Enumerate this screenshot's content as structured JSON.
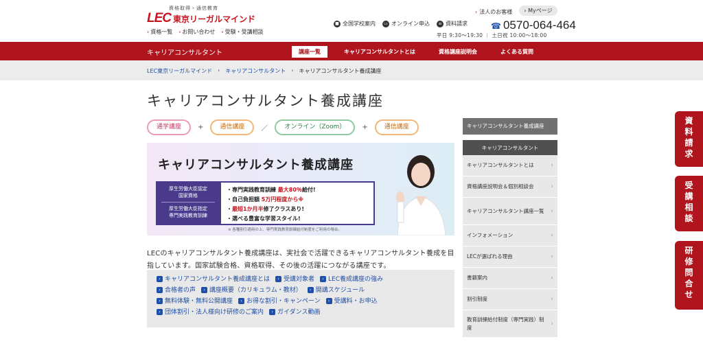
{
  "header": {
    "logo_sub": "資格取得・通信教育",
    "logo_mark": "LEC",
    "logo_name": "東京リーガルマインド",
    "links": [
      "資格一覧",
      "お問い合わせ",
      "受験・受講相談"
    ],
    "utility": [
      "全国学校案内",
      "オンライン申込",
      "資料請求"
    ],
    "corp_link": "法人のお客様",
    "mypage": "Myページ",
    "phone": "0570-064-464",
    "hours": "平日 9:30～19:30 ｜ 土日祝 10:00～18:00"
  },
  "redbar": {
    "title": "キャリアコンサルタント",
    "nav": [
      "講座一覧",
      "キャリアコンサルタントとは",
      "資格講座説明会",
      "よくある質問"
    ]
  },
  "breadcrumb": [
    "LEC東京リーガルマインド",
    "キャリアコンサルタント",
    "キャリアコンサルタント養成講座"
  ],
  "page_title": "キャリアコンサルタント養成講座",
  "pills": {
    "p1": "通学講座",
    "op1": "+",
    "p2": "通信講座",
    "op2": "／",
    "p3": "オンライン（Zoom）",
    "op3": "+",
    "p4": "通信講座"
  },
  "banner": {
    "title": "キャリアコンサルタント養成講座",
    "cert1": "厚生労働大臣認定",
    "cert2": "国家資格",
    "cert3": "厚生労働大臣指定",
    "cert4": "専門実践教育訓練",
    "p1a": "・専門実践教育訓練",
    "p1b": "最大80％",
    "p1c": "給付!",
    "p2a": "・自己負担額",
    "p2b": "5万円程度から※",
    "p3a": "・",
    "p3b": "最短1か月半",
    "p3c": "修了クラスあり!",
    "p4": "・選べる豊富な学習スタイル!",
    "note": "※ 各種割引適用の上、専門実践教育訓練給付制度をご利用の場合。"
  },
  "intro": "LECのキャリアコンサルタント養成講座は、実社会で活躍できるキャリアコンサルタント養成を目指しています。国家試験合格、資格取得、その後の活躍につながる講座です。",
  "links": [
    [
      "キャリアコンサルタント養成講座とは",
      "受講対象者",
      "LEC養成講座の強み"
    ],
    [
      "合格者の声",
      "講座概要（カリキュラム・教材）",
      "開講スケジュール"
    ],
    [
      "無料体験・無料公開講座",
      "お得な割引・キャンペーン",
      "受講料・お申込"
    ],
    [
      "団体割引・法人様向け研修のご案内",
      "ガイダンス動画"
    ]
  ],
  "sidebar": {
    "head1": "キャリアコンサルタント養成講座",
    "head2": "キャリアコンサルタント",
    "items": [
      "キャリアコンサルタントとは",
      "資格講座説明会＆個別相談会",
      "キャリアコンサルタント講座一覧",
      "インフォメーション",
      "LECが選ばれる理由",
      "書籍案内",
      "割引制度",
      "教育訓練給付制度（専門実践）制度"
    ]
  },
  "float": [
    "資料請求",
    "受講相談",
    "研修問合せ"
  ]
}
